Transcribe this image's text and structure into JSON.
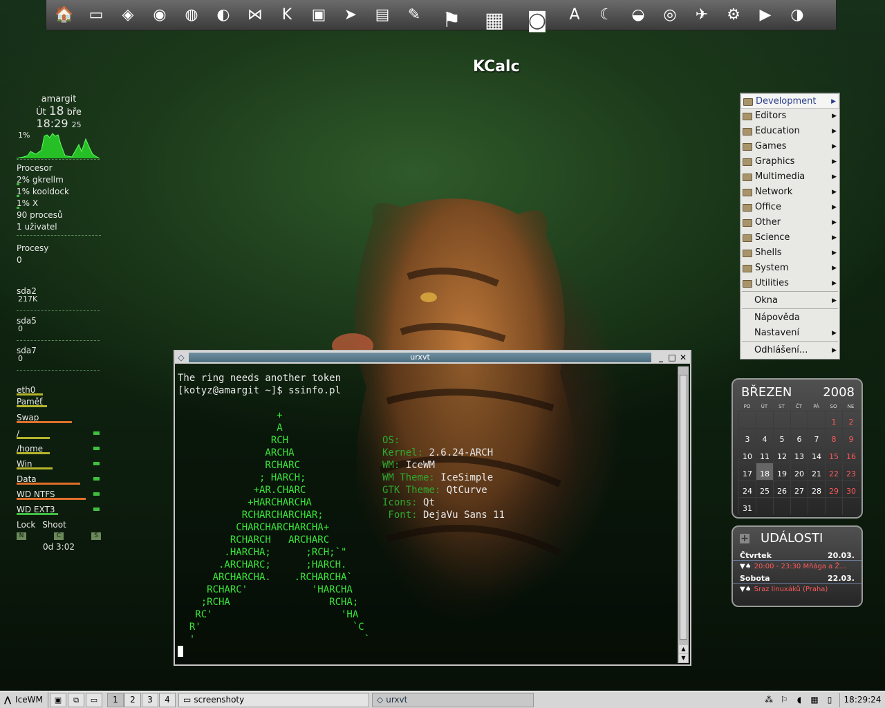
{
  "dock": {
    "label": "KCalc",
    "icons": [
      {
        "name": "home-icon",
        "glyph": "🏠"
      },
      {
        "name": "drive-icon",
        "glyph": "▭"
      },
      {
        "name": "removable-drive-icon",
        "glyph": "◈"
      },
      {
        "name": "firefox-icon",
        "glyph": "◉"
      },
      {
        "name": "globe-icon",
        "glyph": "◍"
      },
      {
        "name": "network-globe-icon",
        "glyph": "◐"
      },
      {
        "name": "network-icon",
        "glyph": "⋈"
      },
      {
        "name": "konqueror-icon",
        "glyph": "K"
      },
      {
        "name": "monitor-icon",
        "glyph": "▣"
      },
      {
        "name": "cursor-window-icon",
        "glyph": "➤"
      },
      {
        "name": "presentation-icon",
        "glyph": "▤"
      },
      {
        "name": "pen-icon",
        "glyph": "✎"
      },
      {
        "name": "flags-icon",
        "glyph": "⚑"
      },
      {
        "name": "calculator-icon",
        "glyph": "▦"
      },
      {
        "name": "photo-camera-icon",
        "glyph": "◙"
      },
      {
        "name": "pdf-icon",
        "glyph": "A"
      },
      {
        "name": "night-sky-icon",
        "glyph": "☾"
      },
      {
        "name": "planet-icon",
        "glyph": "◒"
      },
      {
        "name": "disc-icon",
        "glyph": "◎"
      },
      {
        "name": "compass-icon",
        "glyph": "✈"
      },
      {
        "name": "film-reel-icon",
        "glyph": "⚙"
      },
      {
        "name": "clapper-icon",
        "glyph": "▶"
      },
      {
        "name": "media-player-icon",
        "glyph": "◑"
      }
    ]
  },
  "gkrellm": {
    "host": "amargit",
    "date_day": "Út",
    "date_num": "18",
    "date_month": "bře",
    "time": "18:29",
    "time_sec": "25",
    "cpu_pct": "1%",
    "procesor": "Procesor",
    "proc_rows": [
      {
        "text": "2% gkrellm"
      },
      {
        "text": "1% kooldock"
      },
      {
        "text": "1% X"
      }
    ],
    "procs_count": "90 procesů",
    "users": "1 uživatel",
    "procesy": "Procesy",
    "procesy_val": "0",
    "disks": [
      {
        "name": "sda2",
        "val": "217K"
      },
      {
        "name": "sda5",
        "val": "0"
      },
      {
        "name": "sda7",
        "val": "0"
      }
    ],
    "eth": "eth0",
    "pamet": "Paměť",
    "swap": "Swap",
    "fs": [
      {
        "name": "/",
        "color": "#b5b52a"
      },
      {
        "name": "/home",
        "color": "#b5b52a"
      },
      {
        "name": "Win",
        "color": "#b5b52a"
      },
      {
        "name": "Data",
        "color": "#e0702a"
      },
      {
        "name": "WD NTFS",
        "color": "#e0702a"
      },
      {
        "name": "WD EXT3",
        "color": "#3fbf3f"
      }
    ],
    "lock": "Lock",
    "shoot": "Shoot",
    "btn_n": "N",
    "btn_c": "C",
    "btn_s": "S",
    "uptime": "0d  3:02"
  },
  "terminal": {
    "title": "urxvt",
    "lines": [
      {
        "text": "The ring needs another token",
        "cls": ""
      },
      {
        "text": "[kotyz@amargit ~]$ ssinfo.pl",
        "cls": ""
      }
    ],
    "art": [
      "                 +",
      "                 A",
      "                RCH",
      "               ARCHA",
      "               RCHARC",
      "              ; HARCH;",
      "             +AR.CHARC",
      "            +HARCHARCHA",
      "           RCHARCHARCHAR;",
      "          CHARCHARCHARCHA+",
      "         RCHARCH   ARCHARC",
      "        .HARCHA;      ;RCH;`\"",
      "       .ARCHARC;      ;HARCH.",
      "      ARCHARCHA.    .RCHARCHA`",
      "     RCHARC'           'HARCHA",
      "    ;RCHA                 RCHA;",
      "   RC'                      'HA",
      "  R'                          `C",
      "  '                             `"
    ],
    "info": [
      {
        "key": "OS:",
        "val": ""
      },
      {
        "key": "Kernel:",
        "val": "2.6.24-ARCH"
      },
      {
        "key": "WM:",
        "val": "IceWM"
      },
      {
        "key": "WM Theme:",
        "val": "IceSimple"
      },
      {
        "key": "GTK Theme:",
        "val": "QtCurve"
      },
      {
        "key": "Icons:",
        "val": "Qt"
      },
      {
        "key": " Font:",
        "val": "DejaVu Sans 11"
      }
    ]
  },
  "menu": {
    "items": [
      {
        "label": "Development",
        "arrow": true,
        "folder": true,
        "active": true
      },
      {
        "label": "Editors",
        "arrow": true,
        "folder": true
      },
      {
        "label": "Education",
        "arrow": true,
        "folder": true
      },
      {
        "label": "Games",
        "arrow": true,
        "folder": true
      },
      {
        "label": "Graphics",
        "arrow": true,
        "folder": true
      },
      {
        "label": "Multimedia",
        "arrow": true,
        "folder": true
      },
      {
        "label": "Network",
        "arrow": true,
        "folder": true
      },
      {
        "label": "Office",
        "arrow": true,
        "folder": true
      },
      {
        "label": "Other",
        "arrow": true,
        "folder": true
      },
      {
        "label": "Science",
        "arrow": true,
        "folder": true
      },
      {
        "label": "Shells",
        "arrow": true,
        "folder": true
      },
      {
        "label": "System",
        "arrow": true,
        "folder": true
      },
      {
        "label": "Utilities",
        "arrow": true,
        "folder": true
      }
    ],
    "okna": "Okna",
    "napoveda": "Nápověda",
    "nastaveni": "Nastavení",
    "odhlaseni": "Odhlášení..."
  },
  "calendar": {
    "month": "BŘEZEN",
    "year": "2008",
    "dow": [
      "PO",
      "ÚT",
      "ST",
      "ČT",
      "PÁ",
      "SO",
      "NE"
    ],
    "days": [
      "",
      "",
      "",
      "",
      "",
      "1",
      "2",
      "3",
      "4",
      "5",
      "6",
      "7",
      "8",
      "9",
      "10",
      "11",
      "12",
      "13",
      "14",
      "15",
      "16",
      "17",
      "18",
      "19",
      "20",
      "21",
      "22",
      "23",
      "24",
      "25",
      "26",
      "27",
      "28",
      "29",
      "30",
      "31",
      "",
      "",
      "",
      "",
      "",
      ""
    ],
    "today": "18"
  },
  "events": {
    "title": "UDÁLOSTI",
    "days": [
      {
        "day": "Čtvrtek",
        "date": "20.03.",
        "item": "20:00 - 23:30 Mňága a Ž..."
      },
      {
        "day": "Sobota",
        "date": "22.03.",
        "item": "Sraz linuxáků (Praha)"
      }
    ]
  },
  "taskbar": {
    "start": "IceWM",
    "workspaces": [
      "1",
      "2",
      "3",
      "4"
    ],
    "active_ws": "1",
    "tasks": [
      {
        "label": "screenshoty",
        "icon": "folder-icon"
      },
      {
        "label": "urxvt",
        "icon": "terminal-icon"
      }
    ],
    "clock": "18:29:24"
  }
}
